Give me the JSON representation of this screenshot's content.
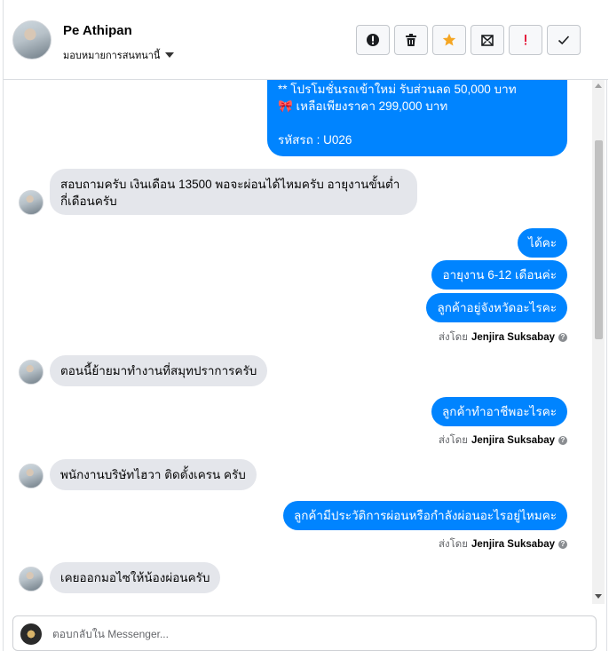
{
  "header": {
    "user_name": "Pe Athipan",
    "assign_label": "มอบหมายการสนทนานี้",
    "toolbar": [
      {
        "name": "report-button",
        "icon": "exclamation-circle-icon"
      },
      {
        "name": "delete-button",
        "icon": "trash-icon"
      },
      {
        "name": "star-button",
        "icon": "star-icon"
      },
      {
        "name": "mark-unread-button",
        "icon": "envelope-icon"
      },
      {
        "name": "spam-button",
        "icon": "exclamation-icon"
      },
      {
        "name": "done-button",
        "icon": "check-icon"
      }
    ]
  },
  "messages": {
    "promo_line1": "** โปรโมชั่นรถเข้าใหม่ รับส่วนลด 50,000 บาท",
    "promo_line2": "🎀 เหลือเพียงราคา 299,000 บาท",
    "promo_code": "รหัสรถ : U026",
    "in1": "สอบถามครับ เงินเดือน 13500 พอจะผ่อนได้ไหมครับ อายุงานขั้นต่ำกี่เดือนครับ",
    "out1": "ได้คะ",
    "out2": "อายุงาน 6-12 เดือนค่ะ",
    "out3": "ลูกค้าอยู่จังหวัดอะไรคะ",
    "in2": "ตอนนี้ย้ายมาทำงานที่สมุทปราการครับ",
    "out4": "ลูกค้าทำอาชีพอะไรคะ",
    "in3": "พนักงานบริษัทไฮวา ติดตั้งเครน ครับ",
    "out5": "ลูกค้ามีประวัติการผ่อนหรือกำลังผ่อนอะไรอยู่ไหมคะ",
    "in4": "เคยออกมอไซให้น้องผ่อนครับ"
  },
  "sent_by": {
    "prefix": "ส่งโดย",
    "agent": "Jenjira Suksabay"
  },
  "composer": {
    "placeholder": "ตอบกลับใน Messenger..."
  },
  "colors": {
    "outgoing_bubble": "#0084ff",
    "incoming_bubble": "#e4e6eb",
    "star": "#f5a623",
    "spam": "#e41e3f"
  }
}
